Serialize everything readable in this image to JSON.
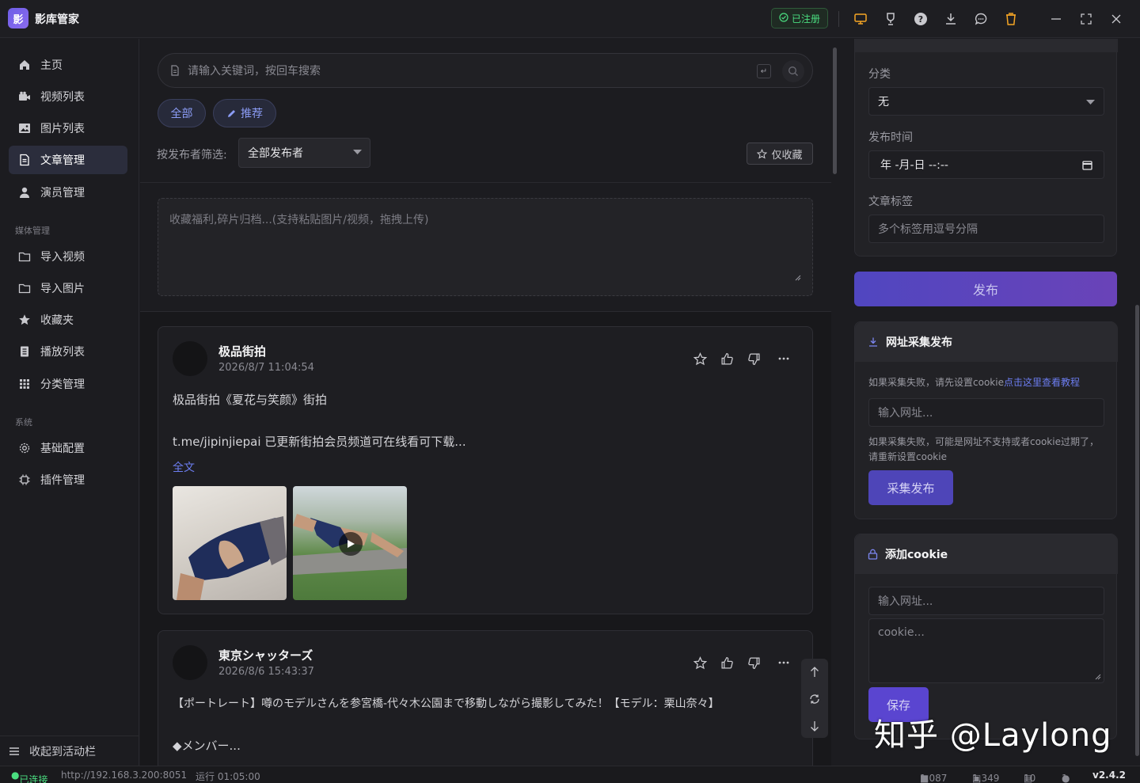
{
  "app": {
    "logo": "影",
    "title": "影库管家",
    "registered": "已注册"
  },
  "sidebar": {
    "items": [
      {
        "label": "主页"
      },
      {
        "label": "视频列表"
      },
      {
        "label": "图片列表"
      },
      {
        "label": "文章管理"
      },
      {
        "label": "演员管理"
      }
    ],
    "section_media": "媒体管理",
    "media_items": [
      {
        "label": "导入视频"
      },
      {
        "label": "导入图片"
      },
      {
        "label": "收藏夹"
      },
      {
        "label": "播放列表"
      },
      {
        "label": "分类管理"
      }
    ],
    "section_system": "系统",
    "system_items": [
      {
        "label": "基础配置"
      },
      {
        "label": "插件管理"
      }
    ],
    "collapse": "收起到活动栏"
  },
  "main": {
    "search_placeholder": "请输入关键词，按回车搜索",
    "kbd": "↵",
    "pill_all": "全部",
    "pill_recommend": "推荐",
    "filter_label": "按发布者筛选:",
    "filter_value": "全部发布者",
    "fav_only": "仅收藏",
    "compose_placeholder": "收藏福利,碎片归档...(支持粘贴图片/视频，拖拽上传)"
  },
  "posts": [
    {
      "name": "极品街拍",
      "time": "2026/8/7 11:04:54",
      "line1": "极品街拍《夏花与笑颜》街拍",
      "line2": "t.me/jipinjiepai 已更新街拍会员频道可在线看可下载...",
      "full": "全文"
    },
    {
      "name": "東京シャッターズ",
      "time": "2026/8/6 15:43:37",
      "line1": "【ポートレート】噂のモデルさんを参宮橋-代々木公園まで移動しながら撮影してみた！【モデル：栗山奈々】",
      "line2": "◆メンバー..."
    }
  ],
  "right": {
    "category_label": "分类",
    "category_value": "无",
    "date_label": "发布时间",
    "date_value": "年 -月-日 --:--",
    "tags_label": "文章标签",
    "tags_placeholder": "多个标签用逗号分隔",
    "publish": "发布",
    "collect_title": "网址采集发布",
    "collect_hint_prefix": "如果采集失败，请先设置cookie",
    "collect_hint_link": "点击这里查看教程",
    "collect_url_placeholder": "输入网址...",
    "collect_warn": "如果采集失败，可能是网址不支持或者cookie过期了，请重新设置cookie",
    "collect_button": "采集发布",
    "cookie_title": "添加cookie",
    "cookie_url_placeholder": "输入网址...",
    "cookie_placeholder": "cookie...",
    "save": "保存"
  },
  "status": {
    "connected": "已连接",
    "url": "http://192.168.3.200:8051",
    "runtime": "运行 01:05:00",
    "videos": "1,087",
    "images": "1,349",
    "articles": "10",
    "actors": "1",
    "version": "v2.4.2"
  },
  "watermark": "知乎 @Laylong",
  "colors": {
    "accent": "#6c7df0",
    "success": "#4ade80",
    "primary_button": "#4e45b8"
  }
}
